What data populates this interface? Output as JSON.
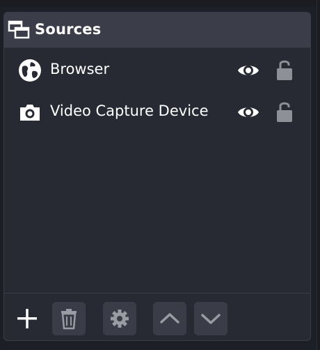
{
  "dock": {
    "title": "Sources",
    "header_icon": "sources-dock-icon"
  },
  "sources": [
    {
      "label": "Browser",
      "type_icon": "globe-icon",
      "visible": true,
      "locked": false
    },
    {
      "label": "Video Capture Device",
      "type_icon": "camera-icon",
      "visible": true,
      "locked": false
    }
  ],
  "toolbar": {
    "buttons": [
      "plus-icon",
      "trash-icon",
      "gear-icon",
      "chevron-up-icon",
      "chevron-down-icon"
    ]
  },
  "colors": {
    "panel": "#272a33",
    "header": "#3b3e48",
    "button": "#3a3d47",
    "text": "#ffffff",
    "lock": "#8e9097"
  }
}
